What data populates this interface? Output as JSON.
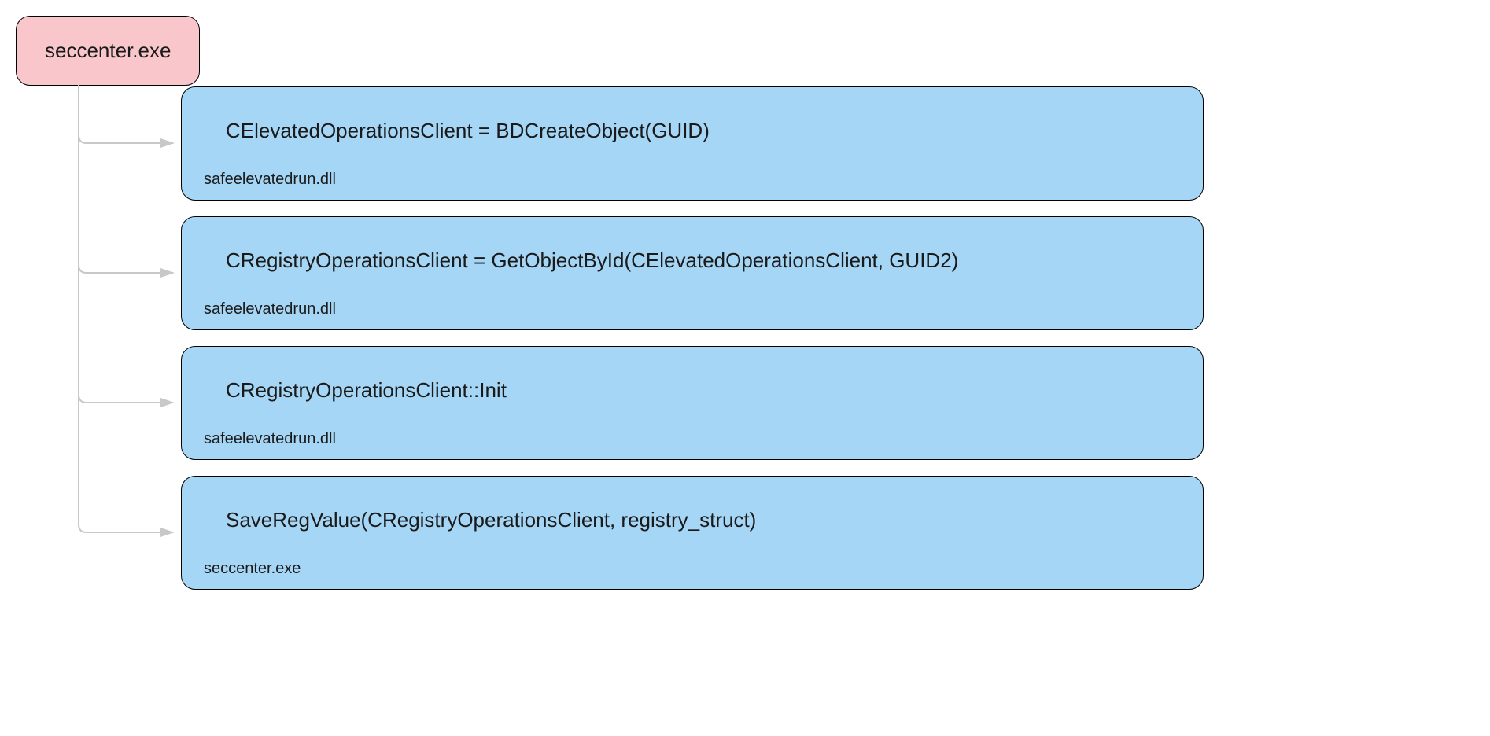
{
  "root": {
    "label": "seccenter.exe"
  },
  "children": [
    {
      "title": "CElevatedOperationsClient = BDCreateObject(GUID)",
      "sub": "safeelevatedrun.dll"
    },
    {
      "title": "CRegistryOperationsClient = GetObjectById(CElevatedOperationsClient, GUID2)",
      "sub": "safeelevatedrun.dll"
    },
    {
      "title": "CRegistryOperationsClient::Init",
      "sub": "safeelevatedrun.dll"
    },
    {
      "title": "SaveRegValue(CRegistryOperationsClient, registry_struct)",
      "sub": "seccenter.exe"
    }
  ]
}
